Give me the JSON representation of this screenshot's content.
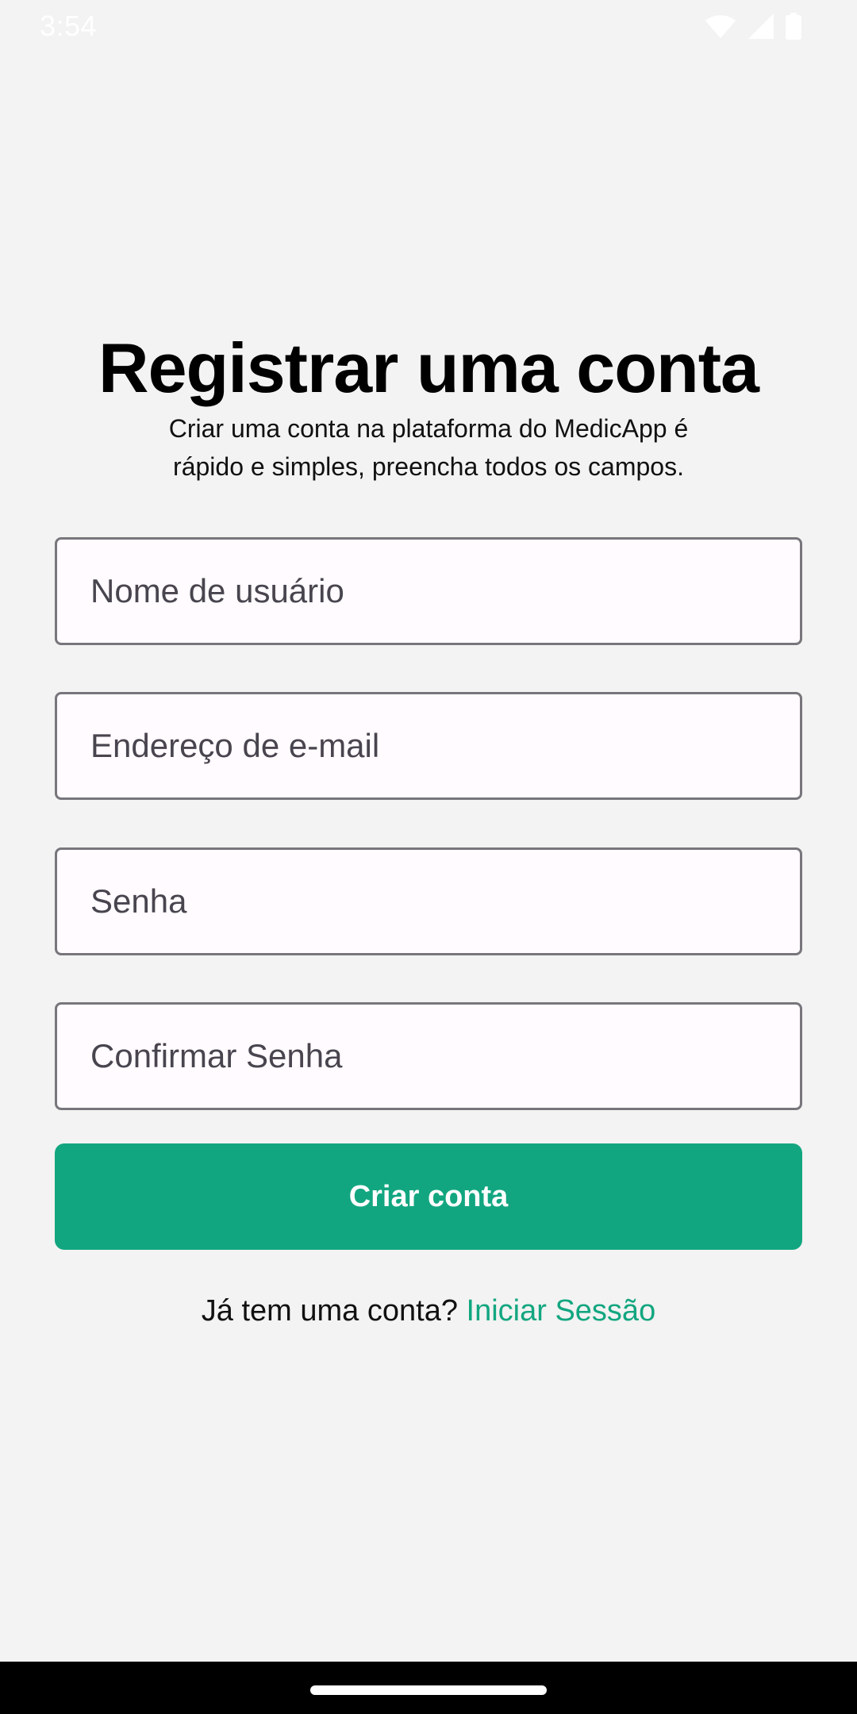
{
  "status_bar": {
    "time": "3:54",
    "icons": [
      "wifi-icon",
      "cellular-signal-icon",
      "battery-icon"
    ]
  },
  "register": {
    "title": "Registrar uma conta",
    "subtitle_line1": "Criar uma conta na plataforma do MedicApp é",
    "subtitle_line2": "rápido e simples, preencha todos os campos.",
    "fields": {
      "username_placeholder": "Nome de usuário",
      "email_placeholder": "Endereço de e-mail",
      "password_placeholder": "Senha",
      "confirm_password_placeholder": "Confirmar Senha"
    },
    "submit_label": "Criar conta",
    "login_prompt": "Já tem uma conta?",
    "login_link": "Iniciar Sessão"
  },
  "colors": {
    "background": "#f2f3f2",
    "accent": "#12a680",
    "field_border": "#78767c",
    "field_fill": "#fffbfe"
  }
}
